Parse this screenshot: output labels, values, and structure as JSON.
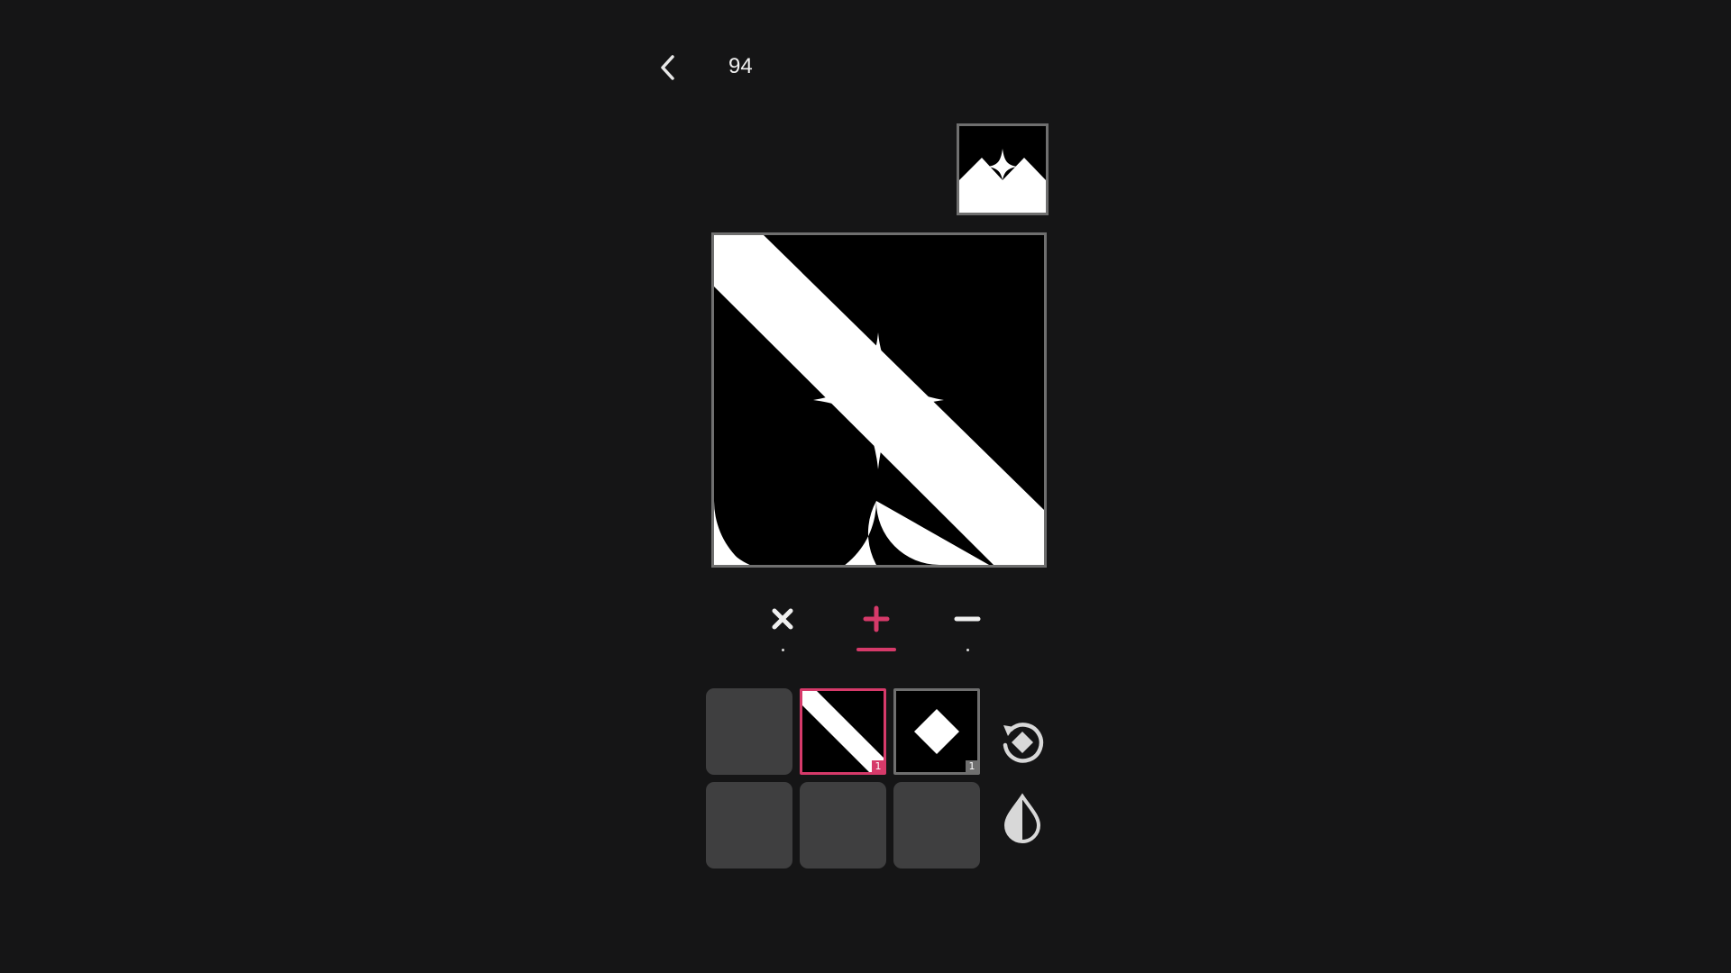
{
  "header": {
    "back_icon": "chevron-left-icon",
    "level_number": "94"
  },
  "target": {
    "icon": "mountain-star-target-icon"
  },
  "canvas": {
    "colors": {
      "fill": "#ffffff",
      "background": "#000000"
    }
  },
  "operations": [
    {
      "name": "intersect",
      "icon": "x-icon",
      "selected": false
    },
    {
      "name": "add",
      "icon": "plus-icon",
      "selected": true
    },
    {
      "name": "subtract",
      "icon": "minus-icon",
      "selected": false
    }
  ],
  "slots": {
    "top_row": [
      {
        "state": "empty"
      },
      {
        "state": "filled",
        "shape": "diagonal-stripe",
        "badge": "1",
        "selected": true
      },
      {
        "state": "filled",
        "shape": "diamond",
        "badge": "1",
        "selected": false
      }
    ],
    "bottom_row": [
      {
        "state": "empty"
      },
      {
        "state": "empty"
      },
      {
        "state": "empty"
      }
    ]
  },
  "tools": {
    "rotate_icon": "rotate-diamond-icon",
    "invert_icon": "invert-drop-icon"
  },
  "colors": {
    "background": "#151516",
    "accent": "#d63a6a",
    "border": "#6f6f6f",
    "empty_slot": "#3f3f40"
  }
}
